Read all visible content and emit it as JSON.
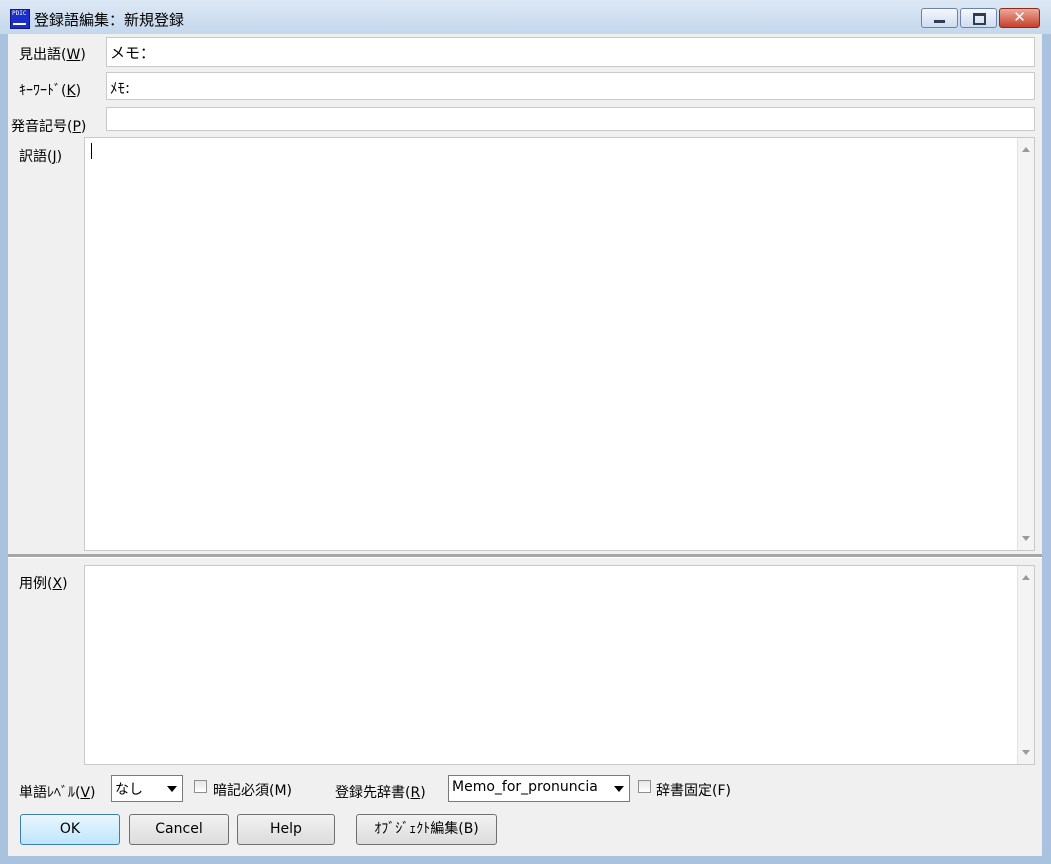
{
  "window": {
    "title": "登録語編集：新規登録",
    "icon_text": "PDIC",
    "close_glyph": "✕"
  },
  "fields": {
    "headword": {
      "label": "見出語(",
      "key": "W",
      "value": "メモ："
    },
    "keyword": {
      "label": "ｷｰﾜｰﾄﾞ(",
      "key": "K",
      "value": "ﾒﾓ:"
    },
    "pronunciation": {
      "label": "発音記号(",
      "key": "P",
      "value": ""
    },
    "translation": {
      "label": "訳語(",
      "key": "J",
      "value": ""
    },
    "example": {
      "label": "用例(",
      "key": "X",
      "value": ""
    }
  },
  "bottom": {
    "level_label": "単語ﾚﾍﾞﾙ(",
    "level_key": "V",
    "level_value": "なし",
    "memorize_label": "暗記必須(M)",
    "dict_label": "登録先辞書(",
    "dict_key": "R",
    "dict_value": "Memo_for_pronuncia",
    "dict_fix_label": "辞書固定(F)",
    "close_paren": ")"
  },
  "buttons": {
    "ok": "OK",
    "cancel": "Cancel",
    "help": "Help",
    "object_edit": "ｵﾌﾞｼﾞｪｸﾄ編集(B)"
  }
}
